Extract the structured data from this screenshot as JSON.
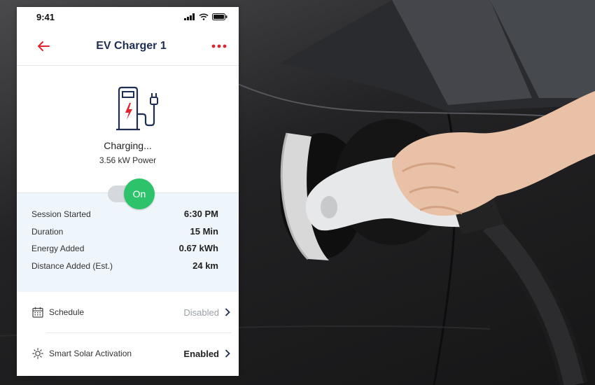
{
  "status_bar": {
    "time": "9:41"
  },
  "header": {
    "title": "EV Charger 1"
  },
  "charger": {
    "status": "Charging...",
    "power": "3.56 kW Power"
  },
  "toggle": {
    "label": "On",
    "state": true,
    "color": "#2dc36b"
  },
  "session": [
    {
      "label": "Session Started",
      "value": "6:30 PM"
    },
    {
      "label": "Duration",
      "value": "15 Min"
    },
    {
      "label": "Energy Added",
      "value": "0.67 kWh"
    },
    {
      "label": "Distance Added (Est.)",
      "value": "24 km"
    }
  ],
  "settings": [
    {
      "icon": "calendar-icon",
      "label": "Schedule",
      "value": "Disabled"
    },
    {
      "icon": "sun-icon",
      "label": "Smart Solar Activation",
      "value": "Enabled"
    }
  ],
  "colors": {
    "accent": "#e0252f",
    "title": "#1f2d52",
    "panel_bg": "#eef5fb",
    "success": "#2dc36b"
  }
}
